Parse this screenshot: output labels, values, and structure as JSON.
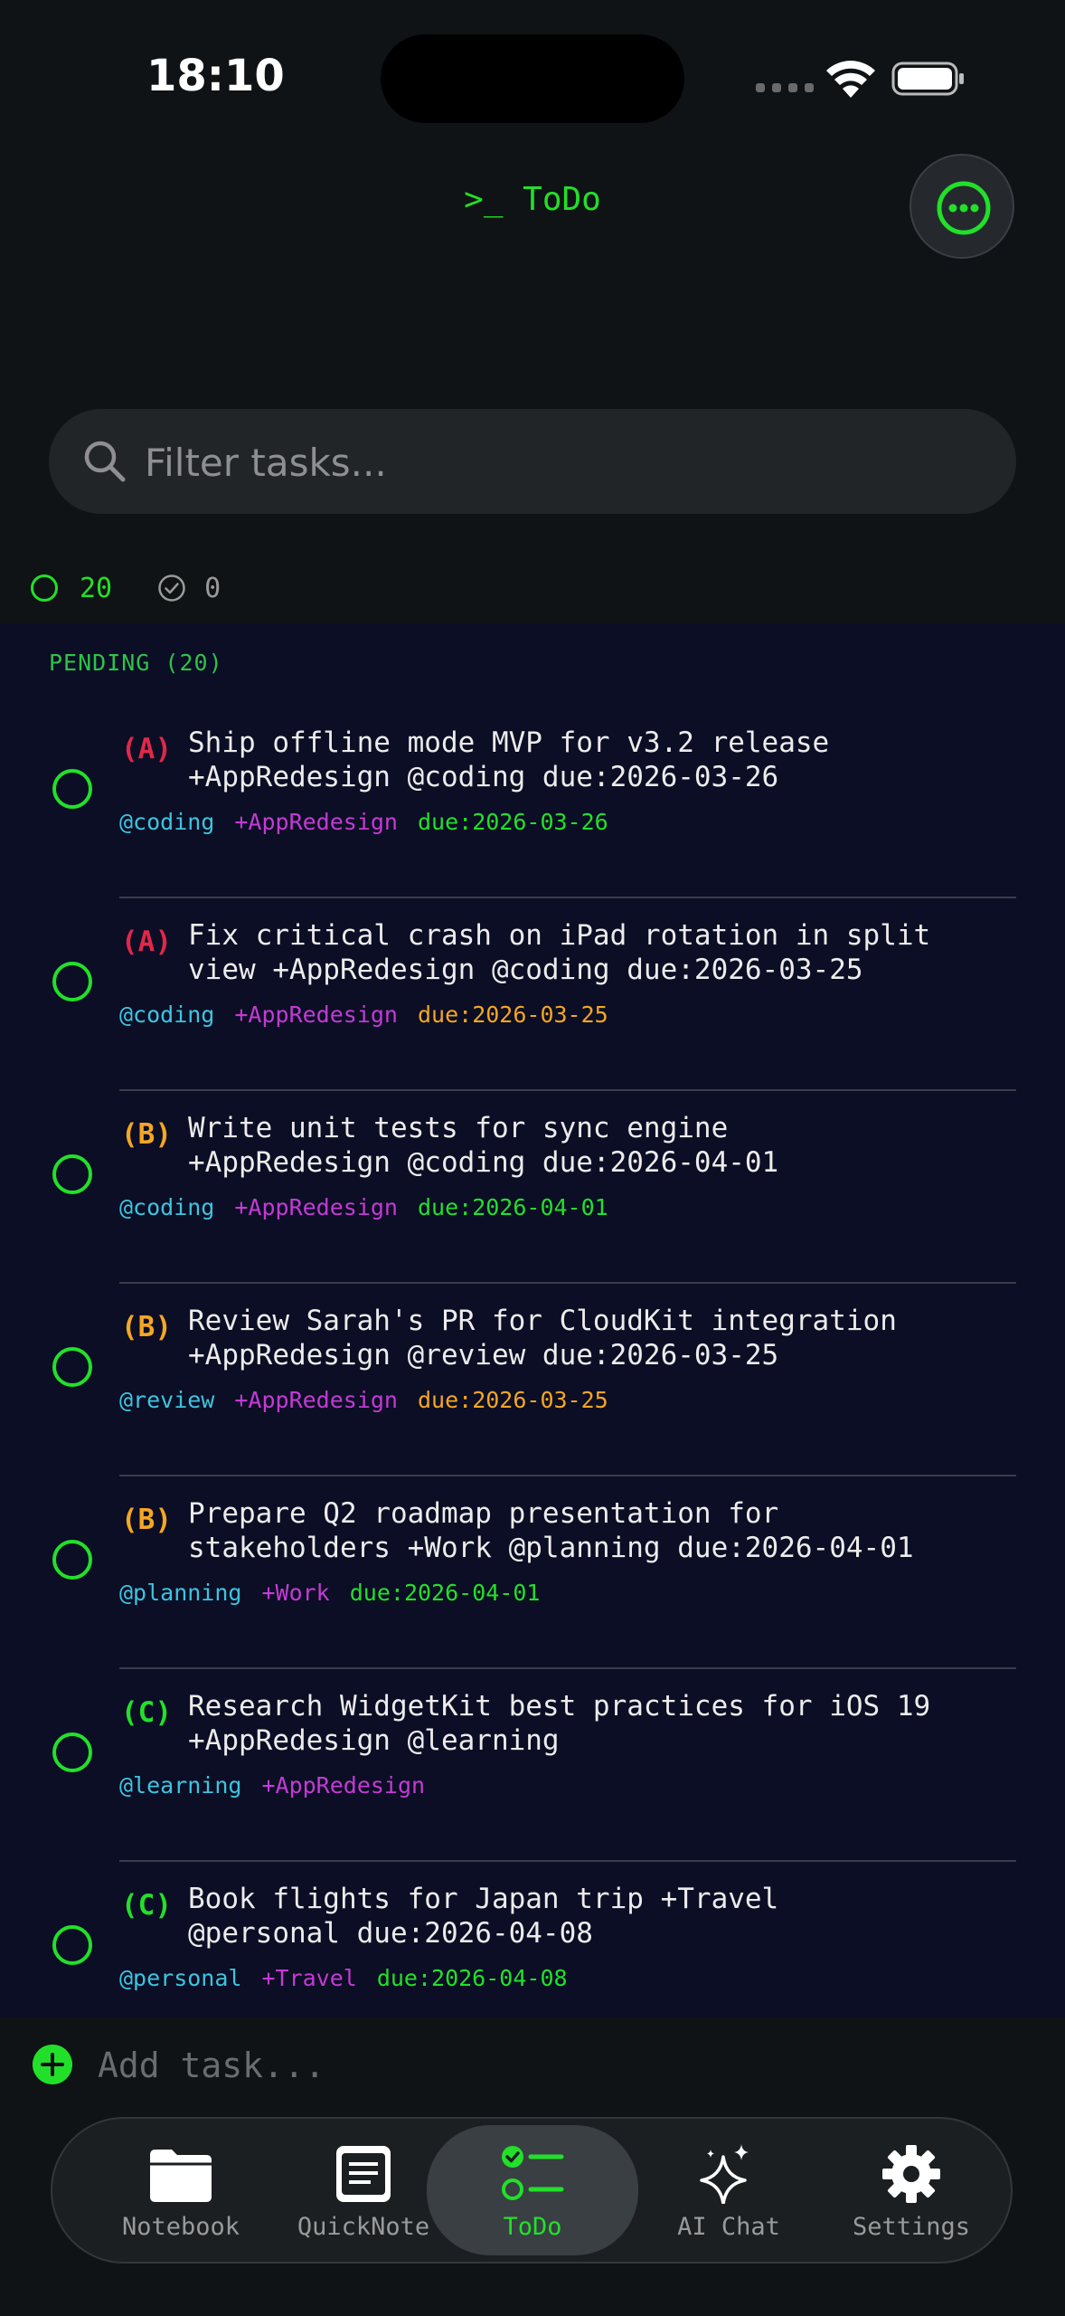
{
  "status_bar": {
    "time": "18:10"
  },
  "header": {
    "title": ">_ ToDo",
    "more_icon": "ellipsis-circle-icon"
  },
  "search": {
    "placeholder": "Filter tasks...",
    "value": ""
  },
  "counts": {
    "pending": "20",
    "done": "0"
  },
  "section": {
    "label": "PENDING (20)"
  },
  "colors": {
    "accent": "#22e02a",
    "priority_a": "#e0284a",
    "priority_b": "#f5a623",
    "priority_c": "#22e02a",
    "context": "#3dc4e0",
    "project": "#c43ad6",
    "due_normal": "#22e02a",
    "due_soon": "#f5a623"
  },
  "tasks": [
    {
      "priority": "(A)",
      "text": "Ship offline mode MVP for v3.2 release\n+AppRedesign @coding due:2026-03-26",
      "context": "@coding",
      "project": "+AppRedesign",
      "due": "due:2026-03-26",
      "due_state": "normal"
    },
    {
      "priority": "(A)",
      "text": "Fix critical crash on iPad rotation in split\nview +AppRedesign @coding due:2026-03-25",
      "context": "@coding",
      "project": "+AppRedesign",
      "due": "due:2026-03-25",
      "due_state": "soon"
    },
    {
      "priority": "(B)",
      "text": "Write unit tests for sync engine\n+AppRedesign @coding due:2026-04-01",
      "context": "@coding",
      "project": "+AppRedesign",
      "due": "due:2026-04-01",
      "due_state": "normal"
    },
    {
      "priority": "(B)",
      "text": "Review Sarah's PR for CloudKit integration\n+AppRedesign @review due:2026-03-25",
      "context": "@review",
      "project": "+AppRedesign",
      "due": "due:2026-03-25",
      "due_state": "soon"
    },
    {
      "priority": "(B)",
      "text": "Prepare Q2 roadmap presentation for\nstakeholders +Work @planning due:2026-04-01",
      "context": "@planning",
      "project": "+Work",
      "due": "due:2026-04-01",
      "due_state": "normal"
    },
    {
      "priority": "(C)",
      "text": "Research WidgetKit best practices for iOS 19\n+AppRedesign @learning",
      "context": "@learning",
      "project": "+AppRedesign",
      "due": "",
      "due_state": "normal"
    },
    {
      "priority": "(C)",
      "text": "Book flights for Japan trip +Travel\n@personal due:2026-04-08",
      "context": "@personal",
      "project": "+Travel",
      "due": "due:2026-04-08",
      "due_state": "normal"
    }
  ],
  "add_task": {
    "placeholder": "Add task..."
  },
  "tabs": [
    {
      "label": "Notebook",
      "icon": "folder-icon",
      "active": false
    },
    {
      "label": "QuickNote",
      "icon": "note-icon",
      "active": false
    },
    {
      "label": "ToDo",
      "icon": "checklist-icon",
      "active": true
    },
    {
      "label": "AI Chat",
      "icon": "sparkles-icon",
      "active": false
    },
    {
      "label": "Settings",
      "icon": "gear-icon",
      "active": false
    }
  ]
}
